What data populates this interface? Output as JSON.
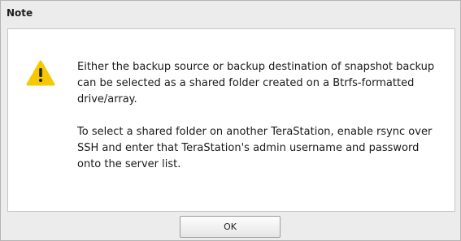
{
  "dialog": {
    "title": "Note",
    "icon": "warning-icon",
    "icon_color": "#F5C800",
    "message_paragraphs": [
      "Either the backup source or backup destination of snapshot backup can be selected as a shared folder created on a Btrfs-formatted drive/array.",
      "To select a shared folder on another TeraStation, enable rsync over SSH and enter that TeraStation's admin username and password onto the server list."
    ],
    "ok_label": "OK"
  }
}
